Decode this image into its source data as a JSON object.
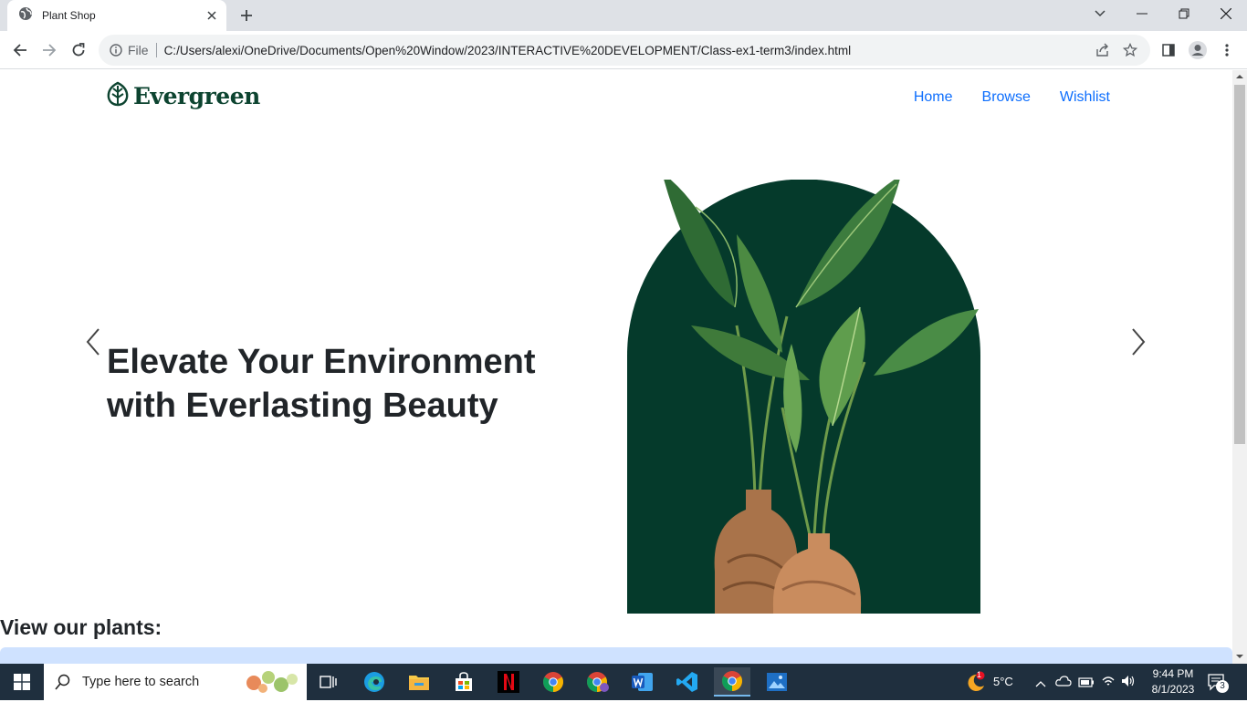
{
  "browser": {
    "tab_title": "Plant Shop",
    "omnibox_file_label": "File",
    "url": "C:/Users/alexi/OneDrive/Documents/Open%20Window/2023/INTERACTIVE%20DEVELOPMENT/Class-ex1-term3/index.html"
  },
  "site": {
    "brand": "Evergreen",
    "nav": [
      "Home",
      "Browse",
      "Wishlist"
    ],
    "hero_title": "Elevate Your Environment with Everlasting Beauty",
    "section_heading": "View our plants:"
  },
  "colors": {
    "brand_green": "#0d4430",
    "arch_green": "#053a2b",
    "link_blue": "#0d6efd",
    "alert_blue": "#cfe2ff",
    "taskbar": "#1f2f3e"
  },
  "taskbar": {
    "search_placeholder": "Type here to search",
    "weather": "5°C",
    "time": "9:44 PM",
    "date": "8/1/2023",
    "notification_count": "3",
    "weather_badge": "1",
    "apps": [
      "task-view",
      "edge",
      "file-explorer",
      "microsoft-store",
      "netflix",
      "chrome",
      "chrome-profile",
      "word",
      "vscode",
      "chrome-active",
      "photos"
    ]
  }
}
